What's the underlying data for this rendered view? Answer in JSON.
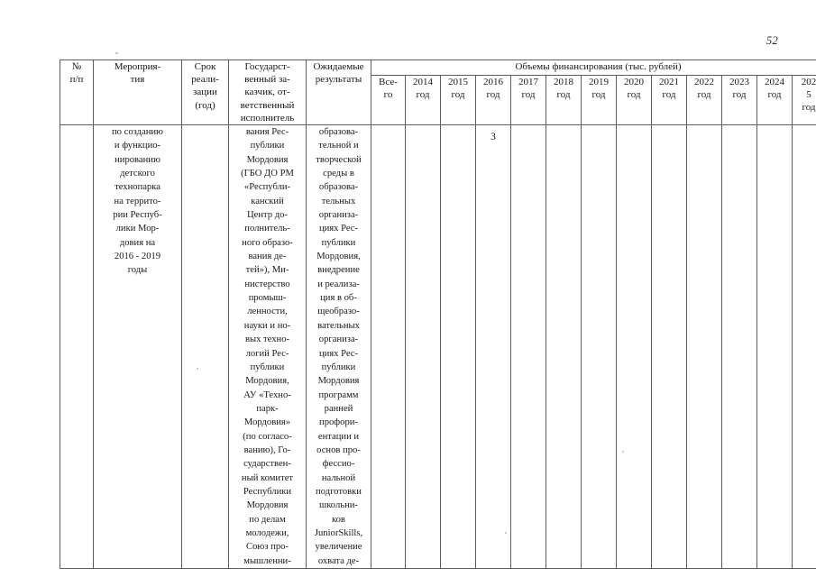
{
  "page": {
    "number": "52"
  },
  "table": {
    "header": {
      "col_no": "№\nп/п",
      "col_event": "Мероприя-\nтия",
      "col_term": "Срок\nреали-\nзации\n(год)",
      "col_customer": "Государст-\nвенный за-\nказчик, от-\nветственный\nисполнитель",
      "col_results": "Ожидаемые\nрезультаты",
      "financing_group": "Объемы финансирования (тыс. рублей)",
      "col_total": "Все-\nго",
      "years": [
        "2014\nгод",
        "2015\nгод",
        "2016\nгод",
        "2017\nгод",
        "2018\nгод",
        "2019\nгод",
        "2020\nгод",
        "2021\nгод",
        "2022\nгод",
        "2023\nгод",
        "2024\nгод",
        "202\n5\nгод"
      ]
    },
    "row": {
      "no": "",
      "event": "по созданию\nи функцио-\nнированию\nдетского\nтехнопарка\nна террито-\nрии Респуб-\nлики Мор-\nдовия на\n2016 - 2019\nгоды",
      "term": "",
      "customer": "вания Рес-\nпублики\nМордовия\n(ГБО ДО РМ\n«Республи-\nканский\nЦентр до-\nполнитель-\nного образо-\nвания де-\nтей»), Ми-\nнистерство\nпромыш-\nленности,\nнауки и но-\nвых техно-\nлогий Рес-\nпублики\nМордовия,\nАУ «Техно-\nпарк-\nМордовия»\n(по согласо-\nванию), Го-\nсударствен-\nный комитет\nРеспублики\nМордовия\nпо делам\nмолодежи,\nСоюз про-\nмышленни-",
      "results": "образова-\nтельной и\nтворческой\nсреды в\nобразова-\nтельных\nорганиза-\nциях Рес-\nпублики\nМордовия,\nвнедрение\nи реализа-\nция в об-\nщеобразо-\nвательных\nорганиза-\nциях Рес-\nпублики\nМордовия\nпрограмм\nранней\nпрофори-\nентации и\nоснов про-\nфессио-\nнальной\nподготовки\nшкольни-\nков\nJuniorSkills,\nувеличение\nохвата де-",
      "total": "",
      "values": [
        "",
        "",
        "3",
        "",
        "",
        "",
        "",
        "",
        "",
        "",
        "",
        ""
      ]
    }
  }
}
